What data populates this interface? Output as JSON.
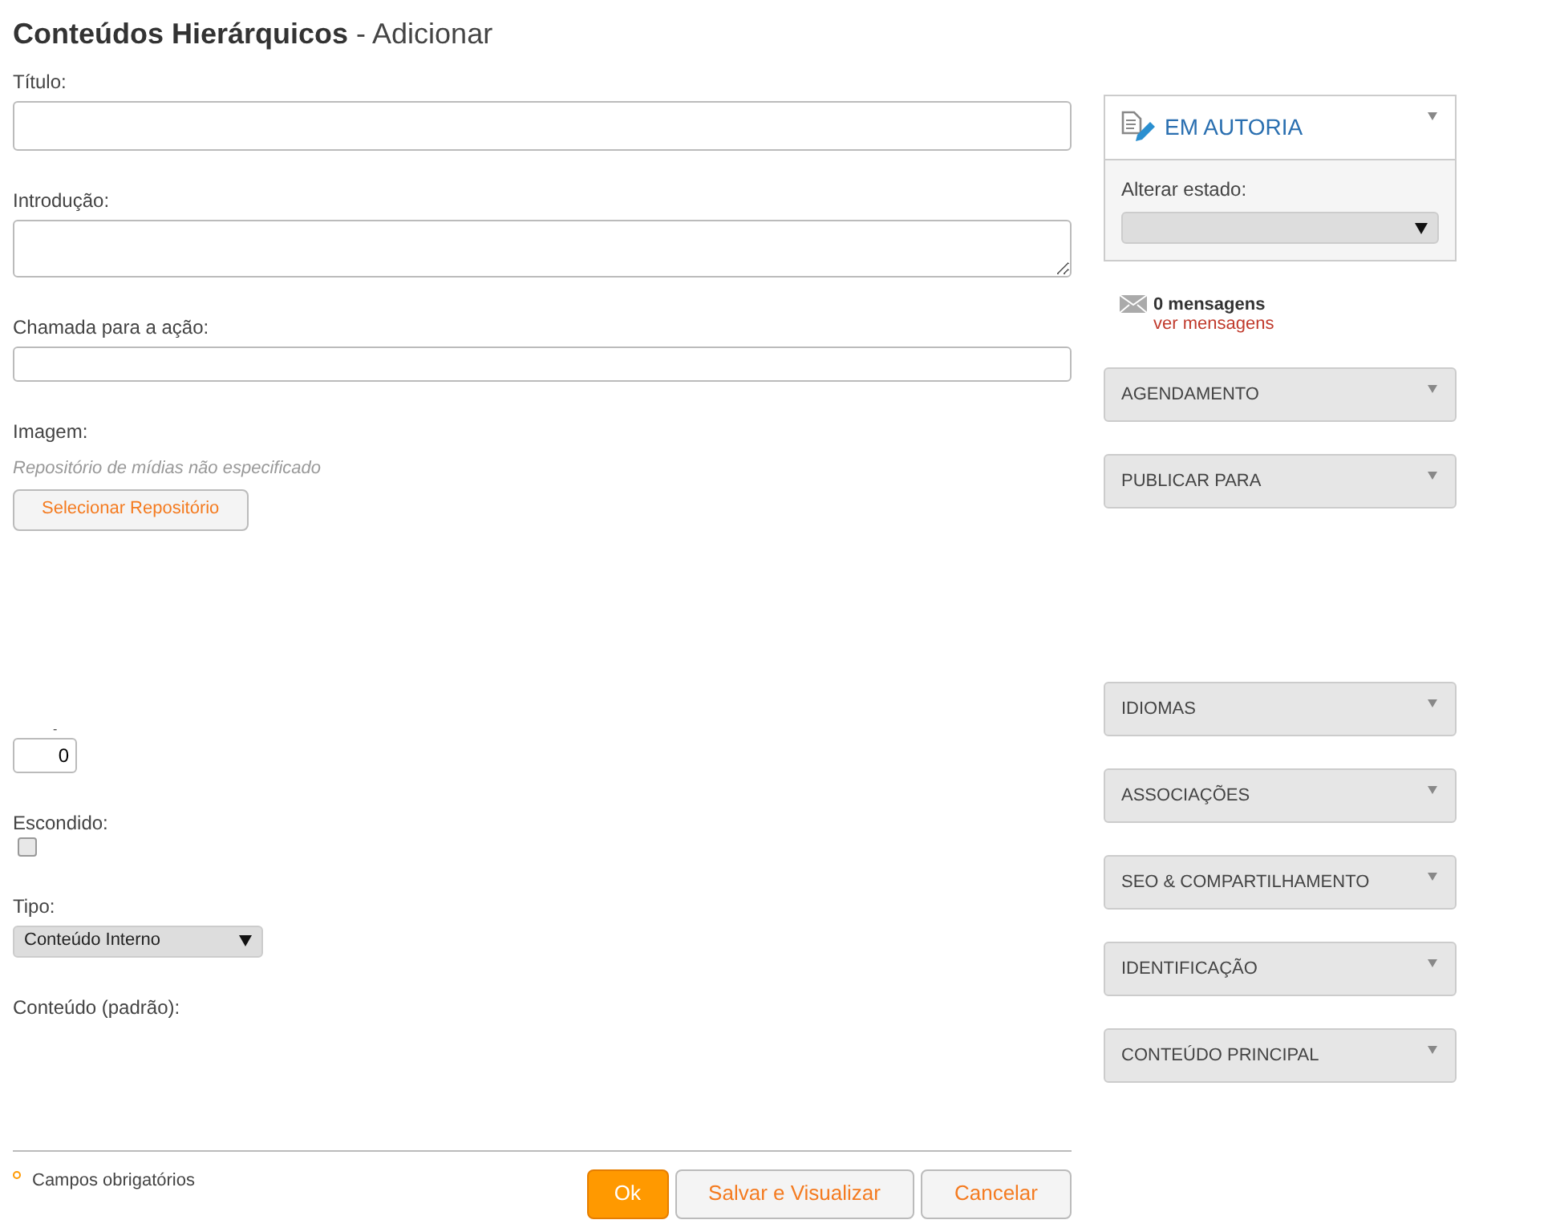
{
  "header": {
    "title": "Conteúdos Hierárquicos",
    "action": "- Adicionar"
  },
  "fields": [
    {
      "kind": "text",
      "label": "Título:"
    },
    {
      "kind": "textarea",
      "label": "Introdução:"
    },
    {
      "kind": "text-small",
      "label": "Chamada para a ação:"
    },
    {
      "kind": "image",
      "label": "Imagem:",
      "note": "Repositório de mídias não especificado",
      "button": "Selecionar Repositório"
    },
    {
      "kind": "number",
      "label": "-",
      "value": "0"
    },
    {
      "kind": "checkbox",
      "label": "Escondido:",
      "checked": false
    },
    {
      "kind": "select",
      "label": "Tipo:",
      "value": "Conteúdo Interno"
    },
    {
      "kind": "editor",
      "label": "Conteúdo (padrão):"
    }
  ],
  "footer": {
    "required_note": "Campos obrigatórios",
    "buttons": [
      {
        "label": "Ok",
        "primary": true
      },
      {
        "label": "Salvar e Visualizar",
        "primary": false
      },
      {
        "label": "Cancelar",
        "primary": false
      }
    ]
  },
  "status_panel": {
    "state": "EM AUTORIA",
    "change_label": "Alterar estado:"
  },
  "messages": {
    "count": "0 mensagens",
    "link": "ver mensagens"
  },
  "section_groups": [
    {
      "sections": [
        "AGENDAMENTO",
        "PUBLICAR PARA"
      ]
    },
    {
      "sections": [
        "IDIOMAS",
        "ASSOCIAÇÕES",
        "SEO & COMPARTILHAMENTO",
        "IDENTIFICAÇÃO",
        "CONTEÚDO PRINCIPAL"
      ]
    }
  ]
}
